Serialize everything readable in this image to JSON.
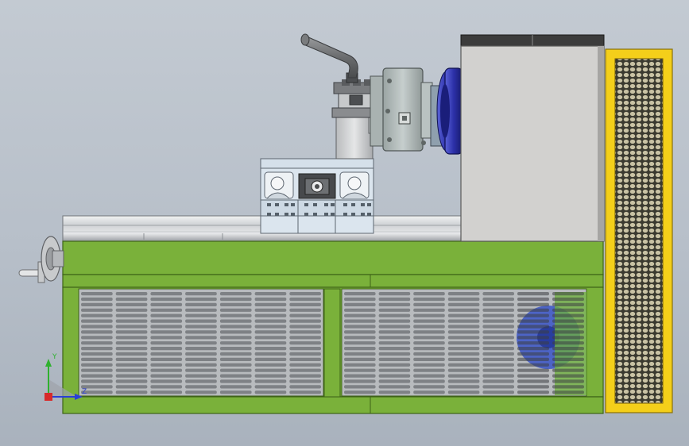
{
  "viewport": {
    "background_top": "#c3cad2",
    "background_bottom": "#a9b2bd"
  },
  "colors": {
    "bed_green": "#7ab13a",
    "bed_green_dark": "#4e7a1c",
    "guard_yellow": "#f4cf1a",
    "headstock_gray": "#d2d1cf",
    "chuck_blue": "#2c30a8",
    "fan_blue": "#3a55c8",
    "vent_gray": "#8d8f92",
    "rail_silver": "#d8dadc"
  },
  "axis_triad": {
    "y_label": "Y",
    "z_label": "Z",
    "y_color": "#2fb12f",
    "z_color": "#2a3fd8",
    "x_color": "#d82a2a"
  }
}
